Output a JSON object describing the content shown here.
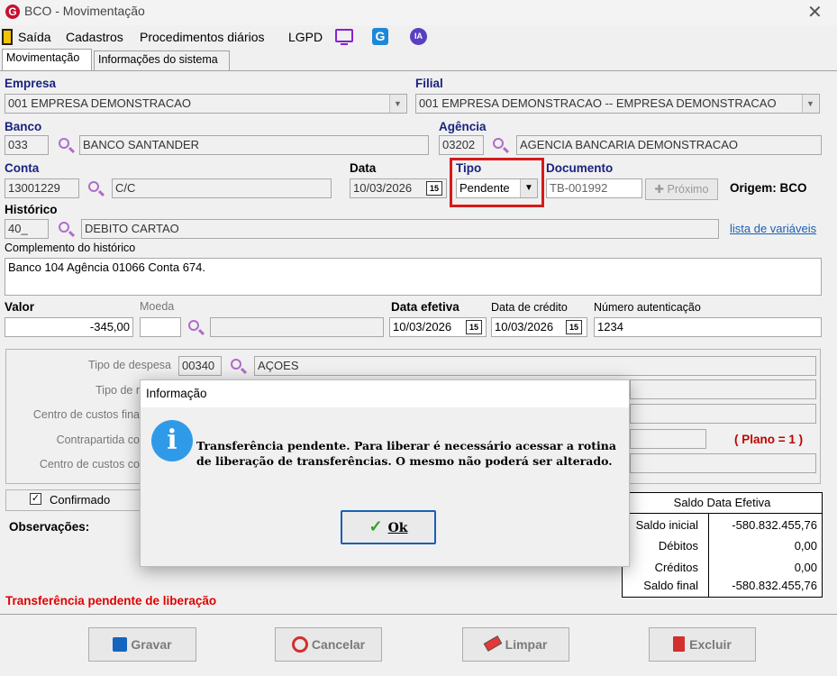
{
  "window": {
    "title": "BCO - Movimentação",
    "logo_letter": "G"
  },
  "menu": {
    "items": [
      "Saída",
      "Cadastros",
      "Procedimentos diários",
      "LGPD"
    ],
    "ia_label": "IA"
  },
  "tabs": [
    "Movimentação",
    "Informações do sistema"
  ],
  "form": {
    "empresa": {
      "label": "Empresa",
      "value": "001 EMPRESA DEMONSTRACAO"
    },
    "filial": {
      "label": "Filial",
      "value": "001 EMPRESA DEMONSTRACAO -- EMPRESA DEMONSTRACAO"
    },
    "banco": {
      "label": "Banco",
      "code": "033",
      "name": "BANCO SANTANDER"
    },
    "agencia": {
      "label": "Agência",
      "code": "03202",
      "name": "AGENCIA BANCARIA DEMONSTRACAO"
    },
    "conta": {
      "label": "Conta",
      "code": "13001229",
      "name": "C/C"
    },
    "data": {
      "label": "Data",
      "value": "10/03/2026"
    },
    "tipo": {
      "label": "Tipo",
      "value": "Pendente"
    },
    "documento": {
      "label": "Documento",
      "value": "TB-001992",
      "proximo_label": "Próximo"
    },
    "origem": "Origem: BCO",
    "historico": {
      "label": "Histórico",
      "code": "40_",
      "name": "DEBITO CARTAO",
      "link": "lista de variáveis"
    },
    "complemento": {
      "label": "Complemento do histórico",
      "value": "Banco 104 Agência 01066 Conta 674."
    },
    "valor": {
      "label": "Valor",
      "value": "-345,00"
    },
    "moeda": {
      "label": "Moeda"
    },
    "data_efetiva": {
      "label": "Data efetiva",
      "value": "10/03/2026"
    },
    "data_credito": {
      "label": "Data de crédito",
      "value": "10/03/2026"
    },
    "numero_autenticacao": {
      "label": "Número autenticação",
      "value": "1234"
    },
    "calendar_glyph": "15"
  },
  "group": {
    "tipo_despesa": {
      "label": "Tipo de despesa",
      "code": "00340",
      "name": "AÇOES"
    },
    "tipo_r_label": "Tipo de r",
    "centro_custos_fina_label": "Centro de custos fina",
    "contrapartida_label": "Contrapartida co",
    "centro_custos_co_label": "Centro de custos co",
    "plano": "( Plano = 1 )"
  },
  "confirmado": {
    "label": "Confirmado",
    "checked": true
  },
  "observacoes_label": "Observações:",
  "status_text": "Transferência pendente de liberação",
  "saldo": {
    "header": "Saldo Data Efetiva",
    "rows": [
      {
        "label": "Saldo inicial",
        "value": "-580.832.455,76"
      },
      {
        "label": "Débitos",
        "value": "0,00"
      },
      {
        "label": "Créditos",
        "value": "0,00"
      },
      {
        "label": "Saldo final",
        "value": "-580.832.455,76"
      }
    ]
  },
  "buttons": {
    "gravar": "Gravar",
    "cancelar": "Cancelar",
    "limpar": "Limpar",
    "excluir": "Excluir"
  },
  "dialog": {
    "title": "Informação",
    "message_line1": "Transferência pendente. Para liberar é necessário acessar a rotina",
    "message_line2": "de liberação de transferências. O mesmo não poderá ser alterado.",
    "ok_label": "Ok"
  },
  "colors": {
    "label_blue": "#1a237e",
    "status_red": "#e00000",
    "highlight_red": "#d7191c",
    "link_blue": "#1a5fb4",
    "icon_purple": "#b06cc8"
  }
}
